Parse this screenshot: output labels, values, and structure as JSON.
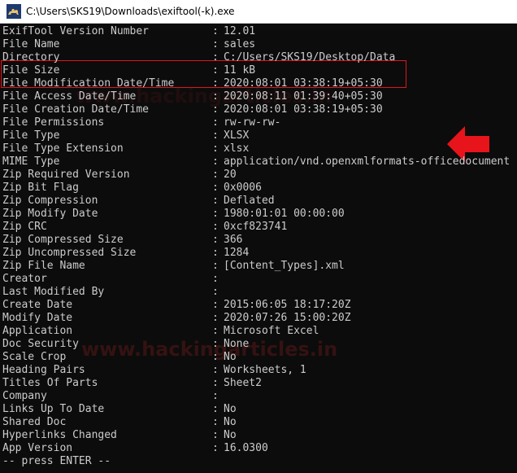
{
  "window": {
    "title": "C:\\Users\\SKS19\\Downloads\\exiftool(-k).exe",
    "icon": "camel-icon"
  },
  "rows": [
    {
      "key": "ExifTool Version Number",
      "value": "12.01"
    },
    {
      "key": "File Name",
      "value": "sales"
    },
    {
      "key": "Directory",
      "value": "C:/Users/SKS19/Desktop/Data"
    },
    {
      "key": "File Size",
      "value": "11 kB"
    },
    {
      "key": "File Modification Date/Time",
      "value": "2020:08:01 03:38:19+05:30"
    },
    {
      "key": "File Access Date/Time",
      "value": "2020:08:11 01:39:40+05:30"
    },
    {
      "key": "File Creation Date/Time",
      "value": "2020:08:01 03:38:19+05:30"
    },
    {
      "key": "File Permissions",
      "value": "rw-rw-rw-"
    },
    {
      "key": "File Type",
      "value": "XLSX"
    },
    {
      "key": "File Type Extension",
      "value": "xlsx"
    },
    {
      "key": "MIME Type",
      "value": "application/vnd.openxmlformats-officedocument"
    },
    {
      "key": "Zip Required Version",
      "value": "20"
    },
    {
      "key": "Zip Bit Flag",
      "value": "0x0006"
    },
    {
      "key": "Zip Compression",
      "value": "Deflated"
    },
    {
      "key": "Zip Modify Date",
      "value": "1980:01:01 00:00:00"
    },
    {
      "key": "Zip CRC",
      "value": "0xcf823741"
    },
    {
      "key": "Zip Compressed Size",
      "value": "366"
    },
    {
      "key": "Zip Uncompressed Size",
      "value": "1284"
    },
    {
      "key": "Zip File Name",
      "value": "[Content_Types].xml"
    },
    {
      "key": "Creator",
      "value": ""
    },
    {
      "key": "Last Modified By",
      "value": ""
    },
    {
      "key": "Create Date",
      "value": "2015:06:05 18:17:20Z"
    },
    {
      "key": "Modify Date",
      "value": "2020:07:26 15:00:20Z"
    },
    {
      "key": "Application",
      "value": "Microsoft Excel"
    },
    {
      "key": "Doc Security",
      "value": "None"
    },
    {
      "key": "Scale Crop",
      "value": "No"
    },
    {
      "key": "Heading Pairs",
      "value": "Worksheets, 1"
    },
    {
      "key": "Titles Of Parts",
      "value": "Sheet2"
    },
    {
      "key": "Company",
      "value": ""
    },
    {
      "key": "Links Up To Date",
      "value": "No"
    },
    {
      "key": "Shared Doc",
      "value": "No"
    },
    {
      "key": "Hyperlinks Changed",
      "value": "No"
    },
    {
      "key": "App Version",
      "value": "16.0300"
    }
  ],
  "separator": ":",
  "prompt": "-- press ENTER --",
  "watermark": "www.hackingarticles.in",
  "colors": {
    "console_bg": "#0c0c0c",
    "console_text": "#cccccc",
    "highlight_border": "#e0161b",
    "arrow": "#e8141b",
    "titlebar_bg": "#ffffff"
  },
  "annotations": {
    "highlight": "red box around File Name and Directory",
    "arrow": "red-arrow-left-icon"
  }
}
